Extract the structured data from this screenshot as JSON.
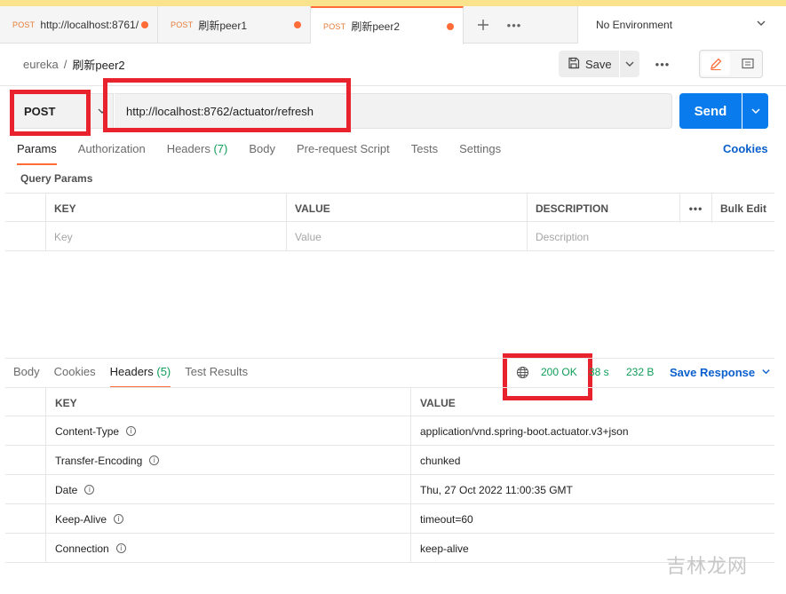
{
  "tabs": [
    {
      "method": "POST",
      "name": "http://localhost:8761/",
      "active": false
    },
    {
      "method": "POST",
      "name": "刷新peer1",
      "active": false
    },
    {
      "method": "POST",
      "name": "刷新peer2",
      "active": true
    }
  ],
  "environment": "No Environment",
  "breadcrumb": {
    "collection": "eureka",
    "separator": "/",
    "request": "刷新peer2"
  },
  "toolbar": {
    "save_label": "Save"
  },
  "request": {
    "method": "POST",
    "url": "http://localhost:8762/actuator/refresh",
    "send_label": "Send"
  },
  "request_tabs": [
    {
      "label": "Params",
      "count": "",
      "active": true
    },
    {
      "label": "Authorization",
      "count": "",
      "active": false
    },
    {
      "label": "Headers",
      "count": "(7)",
      "active": false
    },
    {
      "label": "Body",
      "count": "",
      "active": false
    },
    {
      "label": "Pre-request Script",
      "count": "",
      "active": false
    },
    {
      "label": "Tests",
      "count": "",
      "active": false
    },
    {
      "label": "Settings",
      "count": "",
      "active": false
    }
  ],
  "cookies_link": "Cookies",
  "query_params": {
    "title": "Query Params",
    "columns": {
      "key": "KEY",
      "value": "VALUE",
      "description": "DESCRIPTION",
      "bulk_edit": "Bulk Edit"
    },
    "placeholders": {
      "key": "Key",
      "value": "Value",
      "description": "Description"
    }
  },
  "response_tabs": [
    {
      "label": "Body",
      "count": "",
      "active": false
    },
    {
      "label": "Cookies",
      "count": "",
      "active": false
    },
    {
      "label": "Headers",
      "count": "(5)",
      "active": true
    },
    {
      "label": "Test Results",
      "count": "",
      "active": false
    }
  ],
  "response_meta": {
    "status": "200 OK",
    "time": "38 s",
    "size": "232 B",
    "save_label": "Save Response"
  },
  "response_headers": {
    "columns": {
      "key": "KEY",
      "value": "VALUE"
    },
    "rows": [
      {
        "key": "Content-Type",
        "value": "application/vnd.spring-boot.actuator.v3+json"
      },
      {
        "key": "Transfer-Encoding",
        "value": "chunked"
      },
      {
        "key": "Date",
        "value": "Thu, 27 Oct 2022 11:00:35 GMT"
      },
      {
        "key": "Keep-Alive",
        "value": "timeout=60"
      },
      {
        "key": "Connection",
        "value": "keep-alive"
      }
    ]
  },
  "watermark": "吉林龙网",
  "colors": {
    "accent": "#ff6c37",
    "send": "#097bed",
    "success": "#0f9d58",
    "highlight": "#e8232d",
    "link": "#0b5fcc"
  }
}
